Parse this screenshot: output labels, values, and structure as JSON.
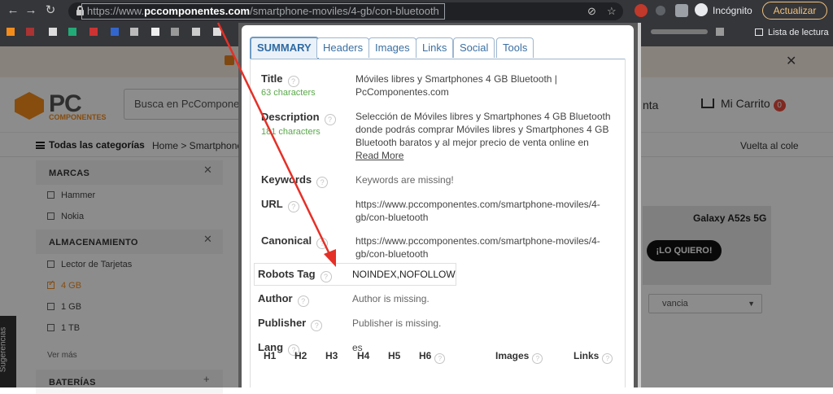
{
  "browser": {
    "url": {
      "scheme": "https://www.",
      "host": "pccomponentes.com",
      "path": "/smartphone-moviles/4-gb/con-bluetooth"
    },
    "profile_label": "Incógnito",
    "update_button": "Actualizar",
    "reading_list": "Lista de lectura",
    "icons": [
      "back-arrow-icon",
      "forward-arrow-icon",
      "reload-icon",
      "lock-icon",
      "eye-off-icon",
      "star-icon",
      "extension-puzzle-icon",
      "incognito-icon"
    ]
  },
  "site": {
    "logo_text": "PC",
    "logo_sub": "COMPONENTES",
    "search_placeholder": "Busca en PcComponen",
    "account_fragment": "nta",
    "cart_label": "Mi Carrito",
    "cart_count": "0",
    "categories_label": "Todas las categorías",
    "breadcrumb": "Home > Smartphones",
    "back_to_school": "Vuelta al cole",
    "filters": {
      "brands_title": "MARCAS",
      "brands": [
        "Hammer",
        "Nokia"
      ],
      "storage_title": "ALMACENAMIENTO",
      "storage": [
        "Lector de Tarjetas",
        "4 GB",
        "1 GB",
        "1 TB"
      ],
      "storage_checked": "4 GB",
      "see_more": "Ver más",
      "batteries_title": "BATERÍAS"
    },
    "suggestions_tab": "Sugerencias",
    "banner": {
      "title": "Galaxy A52s 5G",
      "button": "¡LO QUIERO!"
    },
    "sort_value": "vancia",
    "colors": {
      "accent": "#f48c1c",
      "badge": "#e74c3c"
    }
  },
  "seo": {
    "tabs": [
      "SUMMARY",
      "Headers",
      "Images",
      "Links",
      "Social",
      "Tools"
    ],
    "active_tab": "SUMMARY",
    "title": {
      "label": "Title",
      "count": "63 characters",
      "value": "Móviles libres y Smartphones 4 GB Bluetooth | PcComponentes.com"
    },
    "description": {
      "label": "Description",
      "count": "181 characters",
      "value": "Selección de Móviles libres y Smartphones 4 GB Bluetooth donde podrás comprar Móviles libres y Smartphones 4 GB Bluetooth baratos y al mejor precio de venta online en nuestra",
      "read_more": "Read More"
    },
    "keywords": {
      "label": "Keywords",
      "value": "Keywords are missing!"
    },
    "url": {
      "label": "URL",
      "value": "https://www.pccomponentes.com/smartphone-moviles/4-gb/con-bluetooth"
    },
    "canonical": {
      "label": "Canonical",
      "value": "https://www.pccomponentes.com/smartphone-moviles/4-gb/con-bluetooth"
    },
    "robots": {
      "label": "Robots Tag",
      "value": "NOINDEX,NOFOLLOW"
    },
    "author": {
      "label": "Author",
      "value": "Author is missing."
    },
    "publisher": {
      "label": "Publisher",
      "value": "Publisher is missing."
    },
    "lang": {
      "label": "Lang",
      "value": "es"
    },
    "headers_columns": [
      "H1",
      "H2",
      "H3",
      "H4",
      "H5",
      "H6",
      "Images",
      "Links"
    ],
    "help_glyph": "?"
  }
}
